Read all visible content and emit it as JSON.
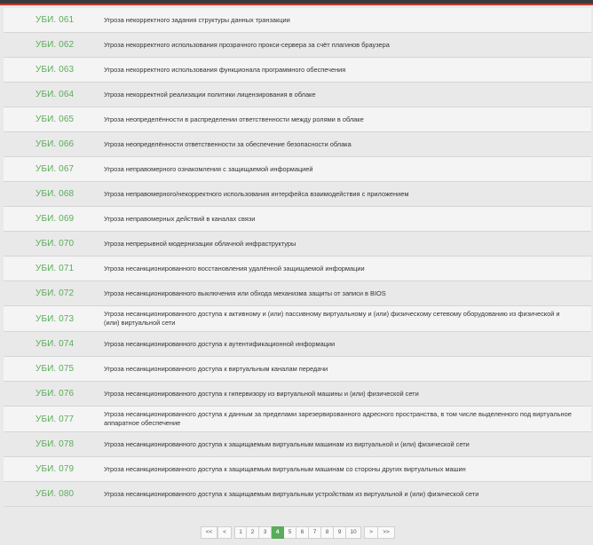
{
  "colors": {
    "accent": "#5aac5a",
    "topbar": "#3b3b3b",
    "topbar_accent": "#c0392b"
  },
  "rows": [
    {
      "code": "УБИ. 061",
      "title": "Угроза некорректного задания структуры данных транзакции"
    },
    {
      "code": "УБИ. 062",
      "title": "Угроза некорректного использования прозрачного прокси-сервера за счёт плагинов браузера"
    },
    {
      "code": "УБИ. 063",
      "title": "Угроза некорректного использования функционала программного обеспечения"
    },
    {
      "code": "УБИ. 064",
      "title": "Угроза некорректной реализации политики лицензирования в облаке"
    },
    {
      "code": "УБИ. 065",
      "title": "Угроза неопределённости в распределении ответственности между ролями в облаке"
    },
    {
      "code": "УБИ. 066",
      "title": "Угроза неопределённости ответственности за обеспечение безопасности облака"
    },
    {
      "code": "УБИ. 067",
      "title": "Угроза неправомерного ознакомления с защищаемой информацией"
    },
    {
      "code": "УБИ. 068",
      "title": "Угроза неправомерного/некорректного использования интерфейса взаимодействия с приложением"
    },
    {
      "code": "УБИ. 069",
      "title": "Угроза неправомерных действий в каналах связи"
    },
    {
      "code": "УБИ. 070",
      "title": "Угроза непрерывной модернизации облачной инфраструктуры"
    },
    {
      "code": "УБИ. 071",
      "title": "Угроза несанкционированного восстановления удалённой защищаемой информации"
    },
    {
      "code": "УБИ. 072",
      "title": "Угроза несанкционированного выключения или обхода механизма защиты от записи в BIOS"
    },
    {
      "code": "УБИ. 073",
      "title": "Угроза несанкционированного доступа к активному и (или) пассивному виртуальному и (или) физическому сетевому оборудованию из физической и (или) виртуальной сети"
    },
    {
      "code": "УБИ. 074",
      "title": "Угроза несанкционированного доступа к аутентификационной информации"
    },
    {
      "code": "УБИ. 075",
      "title": "Угроза несанкционированного доступа к виртуальным каналам передачи"
    },
    {
      "code": "УБИ. 076",
      "title": "Угроза несанкционированного доступа к гипервизору из виртуальной машины и (или) физической сети"
    },
    {
      "code": "УБИ. 077",
      "title": "Угроза несанкционированного доступа к данным за пределами зарезервированного адресного пространства, в том числе выделенного под виртуальное аппаратное обеспечение"
    },
    {
      "code": "УБИ. 078",
      "title": "Угроза несанкционированного доступа к защищаемым виртуальным машинам из виртуальной и (или) физической сети"
    },
    {
      "code": "УБИ. 079",
      "title": "Угроза несанкционированного доступа к защищаемым виртуальным машинам со стороны других виртуальных машин"
    },
    {
      "code": "УБИ. 080",
      "title": "Угроза несанкционированного доступа к защищаемым виртуальным устройствам из виртуальной и (или) физической сети"
    }
  ],
  "pagination": {
    "first": "<<",
    "prev": "<",
    "pages": [
      "1",
      "2",
      "3",
      "4",
      "5",
      "6",
      "7",
      "8",
      "9",
      "10"
    ],
    "current": "4",
    "next": ">",
    "last": ">>"
  }
}
